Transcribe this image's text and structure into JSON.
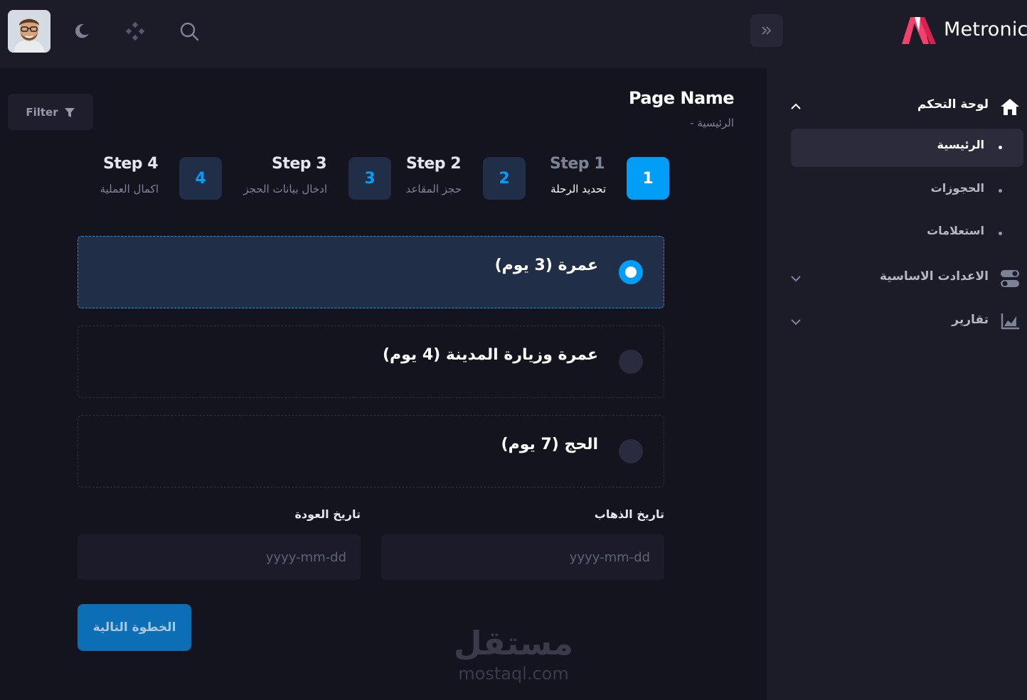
{
  "brand": {
    "name": "Metronic",
    "accent": "#f1416c"
  },
  "topbar": {
    "icons": [
      "moon-icon",
      "apps-icon",
      "search-icon"
    ],
    "collapse_icon": "chevrons-right-icon"
  },
  "sidebar": {
    "dashboard_label": "لوحة التحكم",
    "sub_items": [
      {
        "label": "الرئيسية",
        "active": true
      },
      {
        "label": "الحجوزات",
        "active": false
      },
      {
        "label": "استعلامات",
        "active": false
      }
    ],
    "settings_label": "الاعدادت الاساسية",
    "reports_label": "تقارير"
  },
  "header": {
    "title": "Page Name",
    "breadcrumb": "الرئيسية  -",
    "filter_label": "Filter"
  },
  "stepper": {
    "steps": [
      {
        "num": "1",
        "title": "Step 1",
        "desc": "تحديد الرحلة",
        "active": true
      },
      {
        "num": "2",
        "title": "Step 2",
        "desc": "حجز المقاعد",
        "active": false
      },
      {
        "num": "3",
        "title": "Step 3",
        "desc": "ادخال بيانات الحجز",
        "active": false
      },
      {
        "num": "4",
        "title": "Step 4",
        "desc": "اكمال العملية",
        "active": false
      }
    ]
  },
  "options": [
    {
      "label": "عمرة (3 يوم)",
      "selected": true
    },
    {
      "label": "عمرة وزيارة المدينة (4 يوم)",
      "selected": false
    },
    {
      "label": "الحج (7 يوم)",
      "selected": false
    }
  ],
  "form": {
    "departure_label": "تاريخ الذهاب",
    "departure_placeholder": "yyyy-mm-dd",
    "return_label": "تاريخ العودة",
    "return_placeholder": "yyyy-mm-dd",
    "next_label": "الخطوة التالية"
  },
  "watermark": {
    "arabic": "مستقل",
    "latin": "mostaql.com"
  },
  "colors": {
    "primary": "#009ef7",
    "background": "#14141e",
    "panel": "#1c1c28"
  }
}
